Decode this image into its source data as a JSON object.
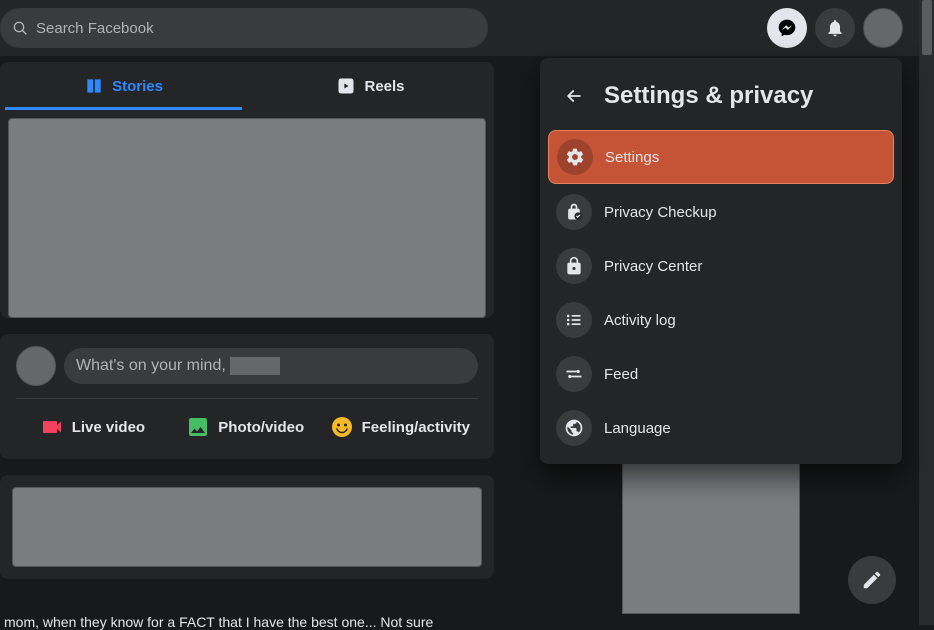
{
  "search": {
    "placeholder": "Search Facebook"
  },
  "tabs": {
    "stories": "Stories",
    "reels": "Reels"
  },
  "composer": {
    "prompt_prefix": "What's on your mind, ",
    "live_video": "Live video",
    "photo_video": "Photo/video",
    "feeling_activity": "Feeling/activity"
  },
  "menu": {
    "title": "Settings & privacy",
    "items": [
      {
        "label": "Settings",
        "icon": "gear"
      },
      {
        "label": "Privacy Checkup",
        "icon": "lock-check"
      },
      {
        "label": "Privacy Center",
        "icon": "lock"
      },
      {
        "label": "Activity log",
        "icon": "list"
      },
      {
        "label": "Feed",
        "icon": "sliders"
      },
      {
        "label": "Language",
        "icon": "globe"
      }
    ]
  },
  "leaked_text": "mom, when they know for a FACT that I have the best one... Not sure"
}
